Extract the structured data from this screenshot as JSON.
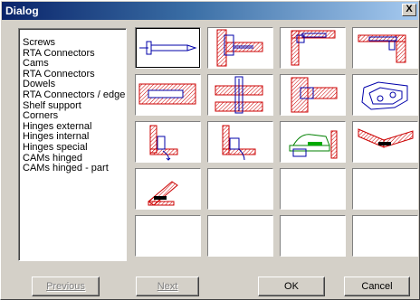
{
  "window": {
    "title": "Dialog",
    "close_label": "X"
  },
  "list": {
    "items": [
      "Screws",
      "RTA Connectors",
      "Cams",
      "RTA Connectors",
      "Dowels",
      "RTA Connectors / edge",
      "Shelf support",
      "Corners",
      "Hinges external",
      "Hinges internal",
      "Hinges special",
      "CAMs hinged",
      "CAMs hinged - part"
    ]
  },
  "gallery": {
    "rows": 5,
    "columns": 4,
    "cells": [
      {
        "icon": "screw-icon"
      },
      {
        "icon": "rta-connector-icon"
      },
      {
        "icon": "cam-icon"
      },
      {
        "icon": "rta-connector-corner-icon"
      },
      {
        "icon": "dowel-icon"
      },
      {
        "icon": "rta-connector-edge-icon"
      },
      {
        "icon": "shelf-support-icon"
      },
      {
        "icon": "corner-bracket-icon"
      },
      {
        "icon": "hinge-external-icon"
      },
      {
        "icon": "hinge-internal-icon"
      },
      {
        "icon": "hinge-special-icon"
      },
      {
        "icon": "cam-hinged-icon"
      },
      {
        "icon": "cam-hinged-part-icon"
      },
      {
        "icon": ""
      },
      {
        "icon": ""
      },
      {
        "icon": ""
      },
      {
        "icon": ""
      },
      {
        "icon": ""
      },
      {
        "icon": ""
      },
      {
        "icon": ""
      }
    ]
  },
  "buttons": {
    "previous": "Previous",
    "next": "Next",
    "ok": "OK",
    "cancel": "Cancel"
  },
  "colors": {
    "titlebar_start": "#0a246a",
    "titlebar_end": "#a6caf0",
    "face": "#d4d0c8",
    "hatch": "#cc0000",
    "outline": "#0000aa"
  }
}
